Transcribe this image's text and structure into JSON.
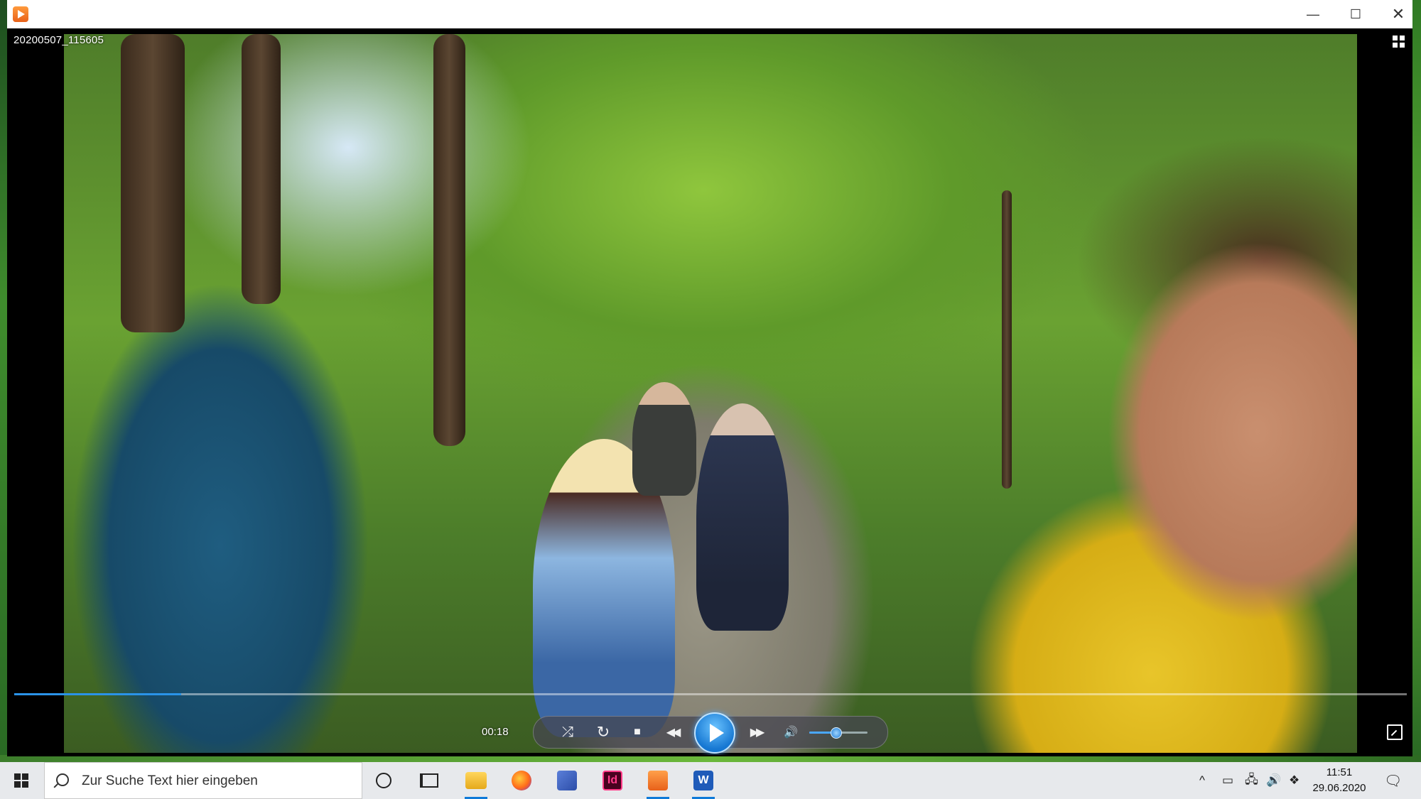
{
  "window": {
    "title_bar_icon": "media-player-icon",
    "controls": {
      "minimize": "—",
      "maximize": "☐",
      "close": "✕"
    }
  },
  "player": {
    "filename": "20200507_115605",
    "current_time": "00:18",
    "seek_progress_fraction": 0.12,
    "volume_fraction": 0.45,
    "accent_color": "#2a93e8",
    "buttons": {
      "shuffle": "⤮",
      "repeat": "↻",
      "stop": "■",
      "rewind": "◀◀",
      "forward": "▶▶",
      "volume": "🔊"
    }
  },
  "taskbar": {
    "search_placeholder": "Zur Suche Text hier eingeben",
    "apps": [
      {
        "name": "cortana-icon",
        "active": false
      },
      {
        "name": "task-view-icon",
        "active": false
      },
      {
        "name": "file-explorer-icon",
        "active": true
      },
      {
        "name": "firefox-icon",
        "active": false
      },
      {
        "name": "network-app-icon",
        "active": false
      },
      {
        "name": "indesign-icon",
        "label": "Id",
        "active": false
      },
      {
        "name": "media-player-icon",
        "active": true
      },
      {
        "name": "word-icon",
        "label": "W",
        "active": true
      }
    ],
    "tray": {
      "chevron": "^",
      "battery": "▭",
      "network": "🖧",
      "volume": "🔊",
      "dropbox": "❖",
      "notifications": "🗨"
    },
    "clock": {
      "time": "11:51",
      "date": "29.06.2020"
    }
  }
}
